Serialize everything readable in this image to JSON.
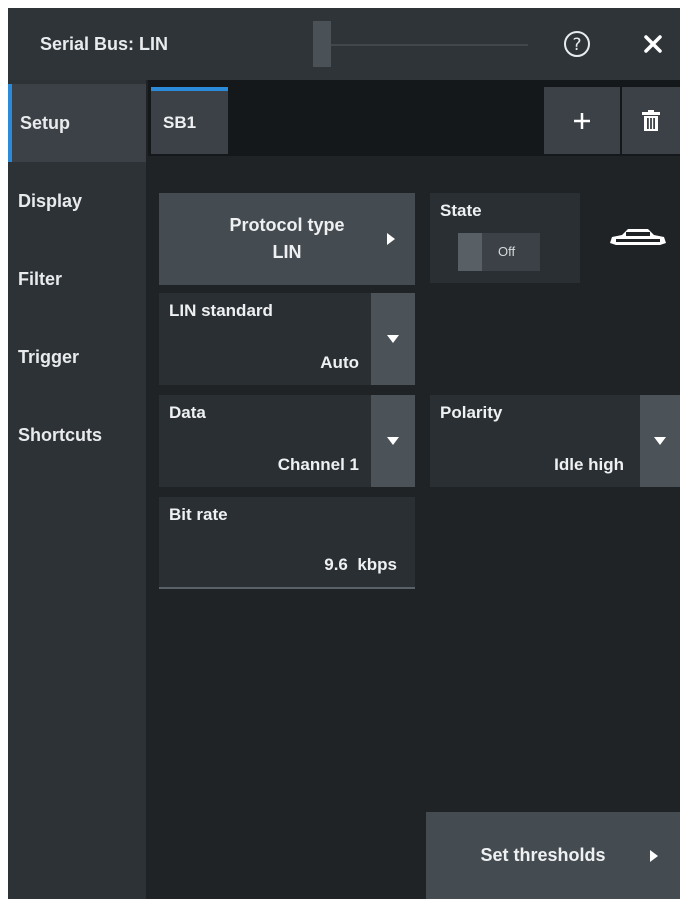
{
  "window": {
    "title": "Serial Bus: LIN",
    "help_icon": "help-circle-icon",
    "close_icon": "close-icon"
  },
  "sidebar": {
    "items": [
      {
        "label": "Setup",
        "active": true
      },
      {
        "label": "Display",
        "active": false
      },
      {
        "label": "Filter",
        "active": false
      },
      {
        "label": "Trigger",
        "active": false
      },
      {
        "label": "Shortcuts",
        "active": false
      }
    ]
  },
  "tabs": {
    "items": [
      {
        "label": "SB1",
        "active": true
      }
    ],
    "add_icon": "plus-icon",
    "delete_icon": "trash-icon"
  },
  "settings": {
    "protocol_type": {
      "label": "Protocol type",
      "value": "LIN"
    },
    "state": {
      "label": "State",
      "value": "Off"
    },
    "lin_standard": {
      "label": "LIN standard",
      "value": "Auto"
    },
    "data": {
      "label": "Data",
      "value": "Channel 1"
    },
    "polarity": {
      "label": "Polarity",
      "value": "Idle high"
    },
    "bit_rate": {
      "label": "Bit rate",
      "value": "9.6  kbps"
    },
    "set_thresholds": {
      "label": "Set thresholds"
    }
  },
  "colors": {
    "accent": "#2b8bd9",
    "background": "#1f2326",
    "panel": "#2a2f33",
    "button": "#454c51"
  }
}
